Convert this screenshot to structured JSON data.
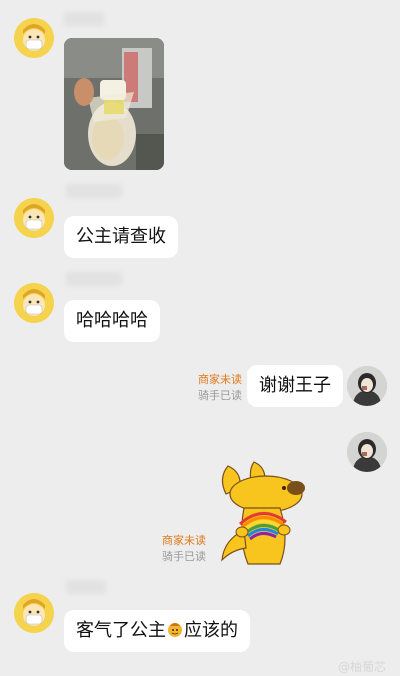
{
  "messages": [
    {
      "side": "left",
      "type": "image",
      "description_label": ""
    },
    {
      "side": "left",
      "type": "text",
      "text": "公主请查收"
    },
    {
      "side": "left",
      "type": "text",
      "text": "哈哈哈哈"
    },
    {
      "side": "right",
      "type": "text",
      "text": "谢谢王子",
      "merchant_status": "商家未读",
      "rider_status": "骑手已读"
    },
    {
      "side": "right",
      "type": "sticker",
      "merchant_status": "商家未读",
      "rider_status": "骑手已读"
    },
    {
      "side": "left",
      "type": "text",
      "text_before": "客气了公主",
      "text_after": "应该的"
    }
  ],
  "icons": {
    "left_avatar": "masked-cartoon-avatar-icon",
    "right_avatar": "user-photo-avatar-icon",
    "sticker": "yellow-dog-rainbow-sticker-icon",
    "inline_emoji": "blessing-emoji-icon"
  },
  "colors": {
    "background": "#ededed",
    "merchant_unread": "#e07a1a",
    "rider_read": "#9a9a9a",
    "bubble": "#ffffff"
  },
  "watermark": "@柚葡芯"
}
